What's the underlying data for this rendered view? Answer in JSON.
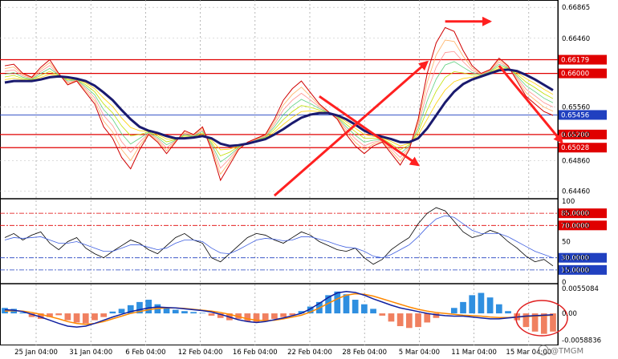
{
  "chart_data": {
    "type": "line",
    "price_panel": {
      "ylim": [
        0.6438,
        0.6694
      ],
      "y_ticks": [
        "0.66865",
        "0.66460",
        "0.65560",
        "0.65200",
        "0.64860",
        "0.64460"
      ],
      "levels": [
        {
          "label": "0.66179",
          "value": 0.66179,
          "color": "#e00000",
          "style": "solid"
        },
        {
          "label": "0.66000",
          "value": 0.66,
          "color": "#e00000",
          "style": "solid"
        },
        {
          "label": "0.65456",
          "value": 0.65456,
          "color": "#2040c0",
          "style": "thin"
        },
        {
          "label": "0.65200",
          "value": 0.652,
          "color": "#e00000",
          "style": "solid"
        },
        {
          "label": "0.65028",
          "value": 0.65028,
          "color": "#e00000",
          "style": "solid"
        }
      ],
      "price": [
        0.661,
        0.6612,
        0.66,
        0.6595,
        0.6608,
        0.6618,
        0.66,
        0.6585,
        0.659,
        0.6575,
        0.656,
        0.653,
        0.6515,
        0.649,
        0.6475,
        0.65,
        0.652,
        0.651,
        0.6495,
        0.651,
        0.6525,
        0.652,
        0.653,
        0.65,
        0.646,
        0.648,
        0.65,
        0.651,
        0.6515,
        0.652,
        0.654,
        0.6565,
        0.658,
        0.659,
        0.6575,
        0.656,
        0.655,
        0.654,
        0.652,
        0.6505,
        0.6495,
        0.6505,
        0.651,
        0.6495,
        0.648,
        0.65,
        0.654,
        0.66,
        0.664,
        0.666,
        0.6655,
        0.663,
        0.661,
        0.66,
        0.6605,
        0.662,
        0.661,
        0.659,
        0.657,
        0.656,
        0.655,
        0.6545
      ],
      "ma_thick": [
        0.6588,
        0.659,
        0.659,
        0.659,
        0.6592,
        0.6595,
        0.6596,
        0.6595,
        0.6593,
        0.659,
        0.6584,
        0.6575,
        0.6565,
        0.6552,
        0.654,
        0.653,
        0.6525,
        0.6522,
        0.6518,
        0.6515,
        0.6515,
        0.6516,
        0.6518,
        0.6515,
        0.6508,
        0.6505,
        0.6506,
        0.6508,
        0.6511,
        0.6514,
        0.652,
        0.6527,
        0.6535,
        0.6542,
        0.6546,
        0.6548,
        0.6548,
        0.6545,
        0.654,
        0.6533,
        0.6525,
        0.652,
        0.6517,
        0.6514,
        0.651,
        0.651,
        0.6515,
        0.6528,
        0.6545,
        0.6562,
        0.6576,
        0.6586,
        0.6592,
        0.6596,
        0.66,
        0.6604,
        0.6605,
        0.6603,
        0.6598,
        0.6592,
        0.6585,
        0.6578
      ],
      "arrows": [
        {
          "from": [
            30,
            0.644
          ],
          "to": [
            47,
            0.6615
          ]
        },
        {
          "from": [
            49,
            0.6668
          ],
          "to": [
            54,
            0.6668
          ]
        },
        {
          "from": [
            55,
            0.661
          ],
          "to": [
            62,
            0.651
          ]
        },
        {
          "from": [
            35,
            0.657
          ],
          "to": [
            46,
            0.648
          ]
        }
      ]
    },
    "rsi_panel": {
      "ylim": [
        0,
        100
      ],
      "y_ticks": [
        "100",
        "85.0000",
        "70.0000",
        "50",
        "30.0000",
        "15.0000",
        "0"
      ],
      "levels": [
        {
          "label": "85.0000",
          "value": 85,
          "color": "#e00000"
        },
        {
          "label": "70.0000",
          "value": 70,
          "color": "#e00000"
        },
        {
          "label": "30.0000",
          "value": 30,
          "color": "#2040c0"
        },
        {
          "label": "15.0000",
          "value": 15,
          "color": "#2040c0"
        }
      ],
      "series": [
        {
          "values": [
            55,
            60,
            52,
            58,
            62,
            48,
            40,
            50,
            55,
            42,
            35,
            30,
            38,
            45,
            52,
            48,
            40,
            35,
            45,
            55,
            60,
            52,
            48,
            30,
            25,
            35,
            45,
            55,
            60,
            58,
            52,
            48,
            55,
            62,
            58,
            50,
            45,
            40,
            38,
            42,
            30,
            22,
            28,
            40,
            48,
            55,
            72,
            85,
            92,
            88,
            75,
            62,
            55,
            58,
            64,
            60,
            50,
            42,
            32,
            25,
            28,
            20
          ]
        },
        {
          "values": [
            52,
            55,
            54,
            55,
            56,
            52,
            48,
            48,
            50,
            46,
            42,
            38,
            38,
            42,
            46,
            46,
            43,
            40,
            42,
            48,
            52,
            52,
            50,
            42,
            36,
            35,
            40,
            46,
            52,
            54,
            53,
            51,
            52,
            56,
            56,
            53,
            50,
            46,
            43,
            42,
            38,
            32,
            30,
            34,
            40,
            46,
            56,
            68,
            78,
            82,
            80,
            72,
            64,
            60,
            60,
            60,
            56,
            50,
            44,
            38,
            34,
            30
          ]
        }
      ]
    },
    "macd_panel": {
      "ylim": [
        -0.0065,
        0.006
      ],
      "y_ticks": [
        "0.0055084",
        "0.00",
        "-0.0058836"
      ],
      "histogram": [
        0.0012,
        0.001,
        0.0002,
        -0.0008,
        -0.0012,
        -0.0008,
        -0.0004,
        -0.0015,
        -0.002,
        -0.0022,
        -0.0015,
        -0.0008,
        0.0004,
        0.001,
        0.0018,
        0.0025,
        0.003,
        0.002,
        0.0012,
        0.0008,
        0.0005,
        0.0003,
        0.0001,
        -0.0005,
        -0.001,
        -0.0015,
        -0.0012,
        -0.0018,
        -0.002,
        -0.0016,
        -0.0012,
        -0.0008,
        -0.0004,
        0.0005,
        0.0015,
        0.0025,
        0.004,
        0.0048,
        0.0042,
        0.003,
        0.002,
        0.001,
        -0.0005,
        -0.0018,
        -0.0028,
        -0.0032,
        -0.003,
        -0.002,
        -0.001,
        0.0,
        0.0012,
        0.0025,
        0.004,
        0.0045,
        0.0035,
        0.002,
        0.0005,
        -0.0015,
        -0.003,
        -0.004,
        -0.0045,
        -0.004
      ],
      "macd": [
        0.0008,
        0.0007,
        0.0004,
        -0.0002,
        -0.0008,
        -0.0015,
        -0.0022,
        -0.0028,
        -0.003,
        -0.0028,
        -0.0022,
        -0.0015,
        -0.0008,
        -0.0002,
        0.0004,
        0.0008,
        0.0012,
        0.0014,
        0.0013,
        0.0012,
        0.001,
        0.0008,
        0.0006,
        0.0003,
        -0.0002,
        -0.0008,
        -0.0014,
        -0.0018,
        -0.002,
        -0.0018,
        -0.0014,
        -0.001,
        -0.0005,
        0.0,
        0.001,
        0.0022,
        0.0035,
        0.0045,
        0.0048,
        0.0046,
        0.004,
        0.0032,
        0.0025,
        0.0018,
        0.0012,
        0.0008,
        0.0004,
        0.0,
        -0.0003,
        -0.0005,
        -0.0006,
        -0.0006,
        -0.0008,
        -0.001,
        -0.0012,
        -0.0012,
        -0.001,
        -0.0008,
        -0.0006,
        -0.0005,
        -0.0004,
        -0.0003
      ],
      "signal": [
        0.0005,
        0.0006,
        0.0005,
        0.0002,
        -0.0002,
        -0.0007,
        -0.0012,
        -0.0018,
        -0.0022,
        -0.0024,
        -0.0022,
        -0.0018,
        -0.0012,
        -0.0006,
        0.0,
        0.0004,
        0.0008,
        0.0011,
        0.0012,
        0.0012,
        0.0011,
        0.0009,
        0.0007,
        0.0005,
        0.0002,
        -0.0002,
        -0.0007,
        -0.0012,
        -0.0015,
        -0.0016,
        -0.0015,
        -0.0012,
        -0.0008,
        -0.0004,
        0.0003,
        0.0012,
        0.0022,
        0.0032,
        0.004,
        0.0043,
        0.0042,
        0.0038,
        0.0032,
        0.0026,
        0.002,
        0.0014,
        0.0009,
        0.0005,
        0.0002,
        0.0,
        -0.0002,
        -0.0004,
        -0.0005,
        -0.0006,
        -0.0008,
        -0.0009,
        -0.0009,
        -0.0008,
        -0.0007,
        -0.0006,
        -0.0005,
        -0.0004
      ]
    },
    "x_ticks": [
      "25 Jan 04:00",
      "31 Jan 04:00",
      "6 Feb 04:00",
      "12 Feb 04:00",
      "16 Feb 04:00",
      "22 Feb 04:00",
      "28 Feb 04:00",
      "5 Mar 04:00",
      "11 Mar 04:00",
      "15 Mar 04:00"
    ],
    "colors": {
      "price": "#d00000",
      "ma": "#1a1a6e",
      "level_red": "#e00000",
      "level_blue": "#2040c0",
      "arrow": "#ff2020",
      "hist_pos": "#2f8fe0",
      "hist_neg": "#f08060",
      "macd": "#1020a0",
      "signal": "#ff8800"
    }
  },
  "watermark": "@TMGM"
}
